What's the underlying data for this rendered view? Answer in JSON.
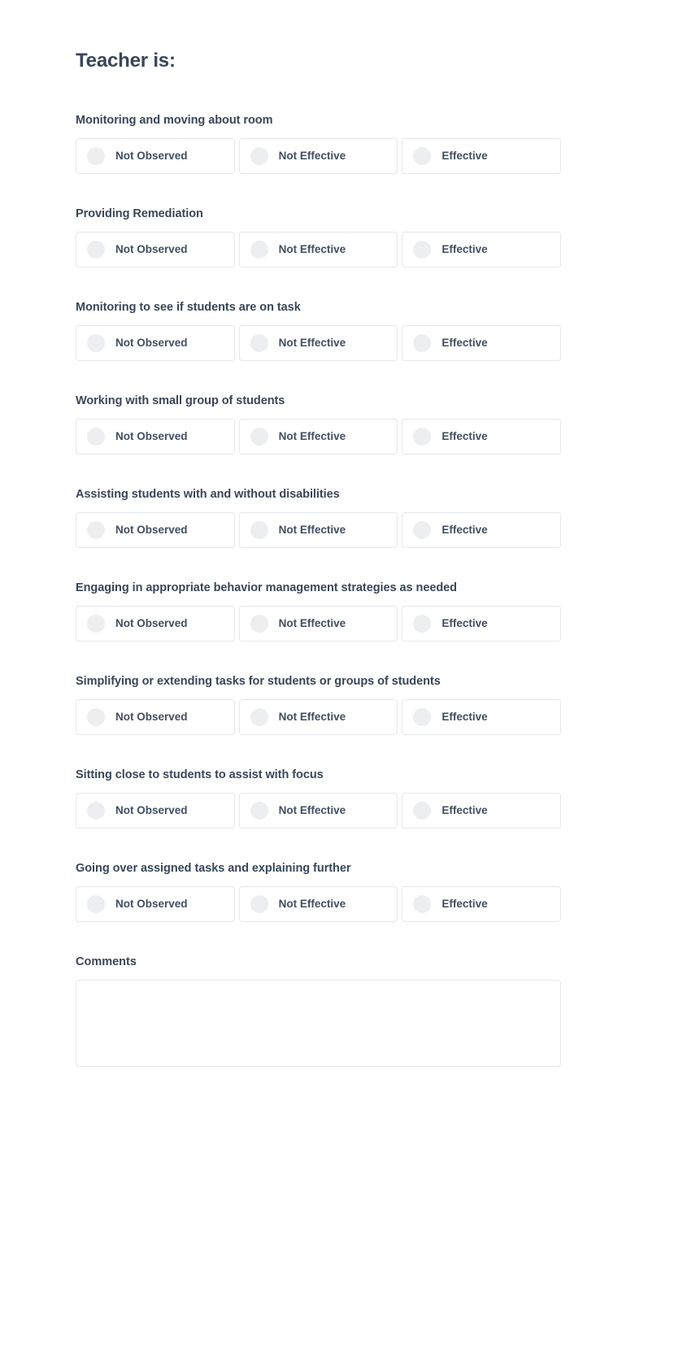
{
  "form": {
    "title": "Teacher is:",
    "option_labels": [
      "Not Observed",
      "Not Effective",
      "Effective"
    ],
    "questions": [
      {
        "label": "Monitoring and moving about room"
      },
      {
        "label": "Providing Remediation"
      },
      {
        "label": "Monitoring to see if students are on task"
      },
      {
        "label": "Working with small group of students"
      },
      {
        "label": "Assisting students with and without disabilities"
      },
      {
        "label": "Engaging in appropriate behavior management strategies as needed"
      },
      {
        "label": "Simplifying or extending tasks for students or groups of students"
      },
      {
        "label": "Sitting close to students to assist with focus"
      },
      {
        "label": "Going over assigned tasks and explaining further"
      }
    ],
    "comments": {
      "label": "Comments",
      "value": "",
      "placeholder": ""
    },
    "colors": {
      "heading_text": "#39465a",
      "option_text": "#414e62",
      "box_border": "#e5e7ea",
      "radio_fill": "#edeef0",
      "background": "#ffffff"
    }
  }
}
